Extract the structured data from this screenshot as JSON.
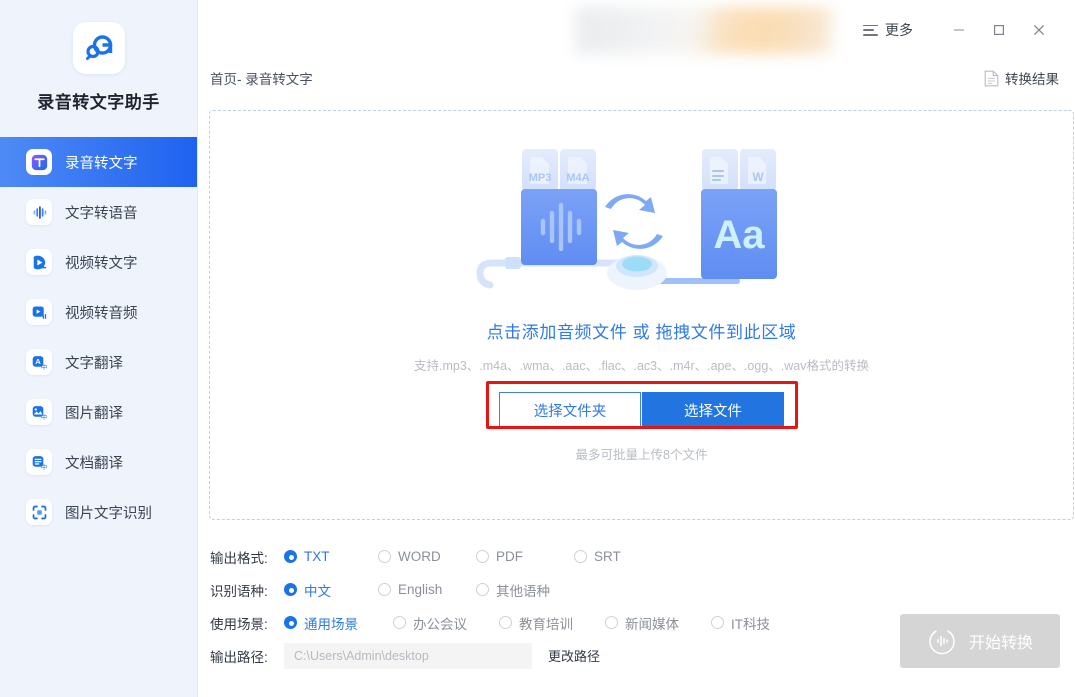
{
  "app": {
    "name": "录音转文字助手",
    "logo_icon": "app-logo-icon"
  },
  "sidebar": {
    "items": [
      {
        "label": "录音转文字",
        "icon": "audio-to-text-icon",
        "active": true
      },
      {
        "label": "文字转语音",
        "icon": "text-to-speech-icon",
        "active": false
      },
      {
        "label": "视频转文字",
        "icon": "video-to-text-icon",
        "active": false
      },
      {
        "label": "视频转音频",
        "icon": "video-to-audio-icon",
        "active": false
      },
      {
        "label": "文字翻译",
        "icon": "text-translate-icon",
        "active": false
      },
      {
        "label": "图片翻译",
        "icon": "image-translate-icon",
        "active": false
      },
      {
        "label": "文档翻译",
        "icon": "doc-translate-icon",
        "active": false
      },
      {
        "label": "图片文字识别",
        "icon": "ocr-icon",
        "active": false
      }
    ]
  },
  "titlebar": {
    "more_label": "更多",
    "more_icon": "hamburger-icon",
    "minimize_icon": "minimize-icon",
    "maximize_icon": "maximize-icon",
    "close_icon": "close-icon"
  },
  "breadcrumb": {
    "text": "首页- 录音转文字"
  },
  "result_link": {
    "label": "转换结果",
    "icon": "document-icon"
  },
  "dropzone": {
    "title": "点击添加音频文件 或 拖拽文件到此区域",
    "supported": "支持.mp3、.m4a、.wma、.aac、.flac、.ac3、.m4r、.ape、.ogg、.wav格式的转换",
    "btn_folder": "选择文件夹",
    "btn_file": "选择文件",
    "note": "最多可批量上传8个文件",
    "illustration": {
      "source_tags": [
        "MP3",
        "M4A"
      ],
      "target_text": "Aa",
      "convert_icon": "sync-arrows-icon"
    },
    "highlight_color": "#e81414"
  },
  "options": {
    "format": {
      "label": "输出格式:",
      "choices": [
        "TXT",
        "WORD",
        "PDF",
        "SRT"
      ],
      "selected": "TXT"
    },
    "language": {
      "label": "识别语种:",
      "choices": [
        "中文",
        "English",
        "其他语种"
      ],
      "selected": "中文"
    },
    "scene": {
      "label": "使用场景:",
      "choices": [
        "通用场景",
        "办公会议",
        "教育培训",
        "新闻媒体",
        "IT科技"
      ],
      "selected": "通用场景"
    },
    "output_path": {
      "label": "输出路径:",
      "placeholder": "C:\\Users\\Admin\\desktop",
      "value": "",
      "change_label": "更改路径"
    }
  },
  "start_button": {
    "label": "开始转换",
    "icon": "waveform-circle-icon",
    "enabled": false,
    "color": "#d5d5d5"
  },
  "colors": {
    "accent": "#2274e0",
    "accent_text": "#2f7ae5",
    "sidebar_bg": "#eef3fc",
    "active_nav": "#1f62ef",
    "muted_text": "#b8bcc4"
  }
}
